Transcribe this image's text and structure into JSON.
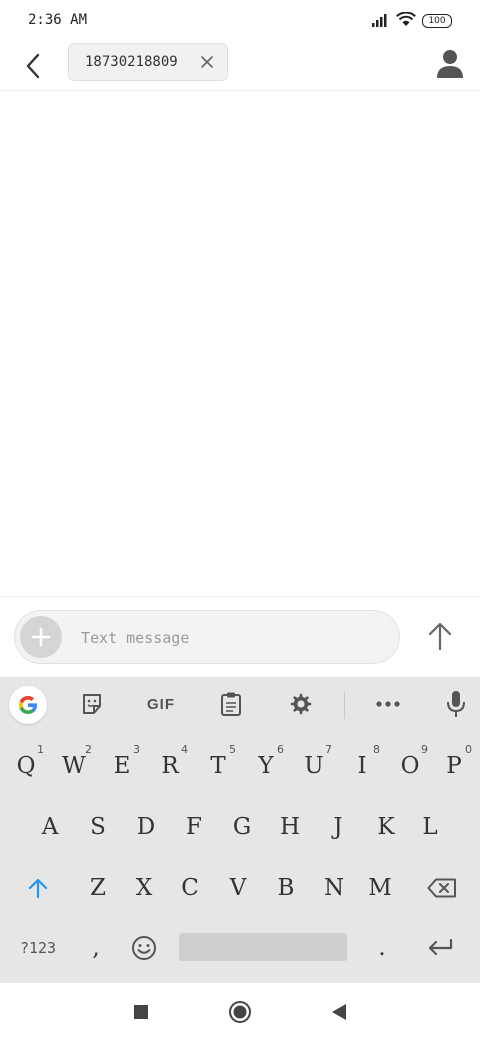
{
  "status_bar": {
    "time": "2:36 AM",
    "battery": "100",
    "icons": [
      "signal-icon",
      "wifi-icon",
      "battery-icon"
    ]
  },
  "header": {
    "recipient": "18730218809",
    "icons": [
      "back-arrow-icon",
      "close-icon",
      "person-icon"
    ]
  },
  "compose": {
    "placeholder": "Text message",
    "value": "",
    "icons": [
      "plus-icon",
      "send-arrow-icon"
    ]
  },
  "keyboard": {
    "toolbar": {
      "gif_label": "GIF",
      "icons": [
        "google-icon",
        "sticker-icon",
        "clipboard-icon",
        "gear-icon",
        "more-icon",
        "mic-icon"
      ]
    },
    "row1": [
      {
        "key": "Q",
        "hint": "1"
      },
      {
        "key": "W",
        "hint": "2"
      },
      {
        "key": "E",
        "hint": "3"
      },
      {
        "key": "R",
        "hint": "4"
      },
      {
        "key": "T",
        "hint": "5"
      },
      {
        "key": "Y",
        "hint": "6"
      },
      {
        "key": "U",
        "hint": "7"
      },
      {
        "key": "I",
        "hint": "8"
      },
      {
        "key": "O",
        "hint": "9"
      },
      {
        "key": "P",
        "hint": "0"
      }
    ],
    "row2": [
      "A",
      "S",
      "D",
      "F",
      "G",
      "H",
      "J",
      "K",
      "L"
    ],
    "row3": [
      "Z",
      "X",
      "C",
      "V",
      "B",
      "N",
      "M"
    ],
    "row4": {
      "symbols": "?123",
      "comma": ",",
      "period": "."
    },
    "accent_color": "#2196f3"
  },
  "nav_bar": {
    "icons": [
      "recent-apps-icon",
      "home-icon",
      "back-icon"
    ]
  }
}
